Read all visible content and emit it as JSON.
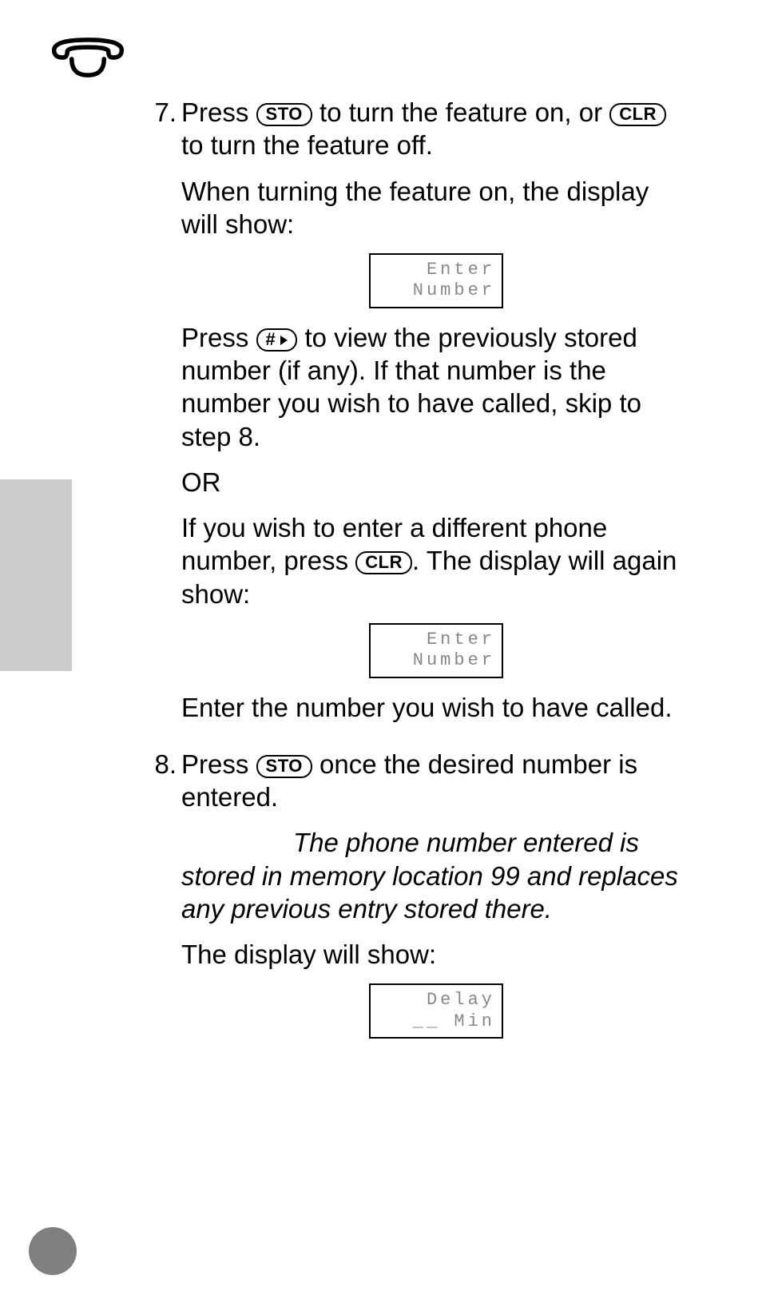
{
  "icons": {
    "header": "on-hook-phone-icon"
  },
  "keys": {
    "sto": "STO",
    "clr": "CLR",
    "hash": "#"
  },
  "steps": {
    "s7": {
      "num": "7.",
      "p1a": "Press ",
      "p1b": " to turn the feature on, or ",
      "p1c": " to turn the feature off.",
      "p2": "When turning the feature on, the display will show:",
      "lcd1_l1": "Enter",
      "lcd1_l2": "Number",
      "p3a": "Press ",
      "p3b": " to view the previously stored number (if any). If that number is the number you wish to have called, skip to step 8.",
      "or": "OR",
      "p4a": "If you wish to enter a different phone number, press ",
      "p4b": ". The display will again show:",
      "lcd2_l1": "Enter",
      "lcd2_l2": "Number",
      "p5": "Enter the number you wish to have called."
    },
    "s8": {
      "num": "8.",
      "p1a": "Press ",
      "p1b": " once the desired number is entered.",
      "note": "The phone number entered is stored in memory location 99 and replaces any previous entry stored there.",
      "p2": "The display will show:",
      "lcd_l1": "Delay",
      "lcd_l2": "__ Min"
    }
  }
}
